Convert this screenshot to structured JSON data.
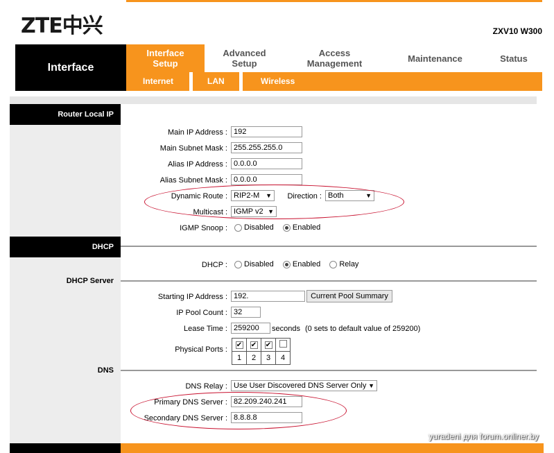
{
  "brand": {
    "logo": "ZTE中兴",
    "model": "ZXV10 W300"
  },
  "nav": {
    "section": "Interface",
    "tabs": [
      {
        "label": "Interface\nSetup",
        "active": true
      },
      {
        "label": "Advanced\nSetup"
      },
      {
        "label": "Access\nManagement"
      },
      {
        "label": "Maintenance"
      },
      {
        "label": "Status"
      }
    ],
    "subtabs": [
      "Internet",
      "LAN",
      "Wireless"
    ]
  },
  "router_local_ip": {
    "section_label": "Router Local IP",
    "main_ip_label": "Main IP Address :",
    "main_ip_value": "192",
    "main_subnet_label": "Main Subnet Mask :",
    "main_subnet_value": "255.255.255.0",
    "alias_ip_label": "Alias IP Address :",
    "alias_ip_value": "0.0.0.0",
    "alias_subnet_label": "Alias Subnet Mask :",
    "alias_subnet_value": "0.0.0.0",
    "dynamic_route_label": "Dynamic Route :",
    "dynamic_route_value": "RIP2-M",
    "direction_label": "Direction :",
    "direction_value": "Both",
    "multicast_label": "Multicast :",
    "multicast_value": "IGMP v2",
    "igmp_snoop_label": "IGMP Snoop :",
    "igmp_disabled": "Disabled",
    "igmp_enabled": "Enabled"
  },
  "dhcp": {
    "section_label": "DHCP",
    "dhcp_label": "DHCP :",
    "opt_disabled": "Disabled",
    "opt_enabled": "Enabled",
    "opt_relay": "Relay",
    "server_label": "DHCP Server",
    "start_ip_label": "Starting IP Address :",
    "start_ip_value": "192.",
    "pool_summary_button": "Current Pool Summary",
    "pool_count_label": "IP Pool Count :",
    "pool_count_value": "32",
    "lease_label": "Lease Time :",
    "lease_value": "259200",
    "lease_unit": "seconds",
    "lease_hint": "(0 sets to default value of 259200)",
    "ports_label": "Physical Ports :",
    "ports": [
      {
        "num": "1",
        "checked": true
      },
      {
        "num": "2",
        "checked": true
      },
      {
        "num": "3",
        "checked": true
      },
      {
        "num": "4",
        "checked": false
      }
    ]
  },
  "dns": {
    "section_label": "DNS",
    "relay_label": "DNS Relay :",
    "relay_value": "Use User Discovered DNS Server Only",
    "primary_label": "Primary DNS Server :",
    "primary_value": "82.209.240.241",
    "secondary_label": "Secondary DNS Server :",
    "secondary_value": "8.8.8.8"
  },
  "watermark": "yuradeni для forum.onliner.by",
  "colors": {
    "accent": "#f7941d",
    "annotation": "#c8102e"
  }
}
